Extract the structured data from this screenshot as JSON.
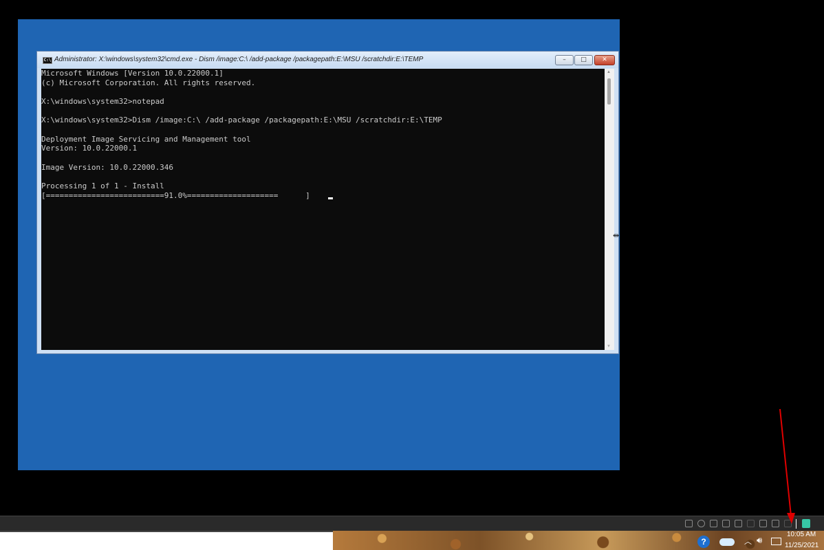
{
  "cmd_window": {
    "title": "Administrator: X:\\windows\\system32\\cmd.exe - Dism  /image:C:\\ /add-package /packagepath:E:\\MSU /scratchdir:E:\\TEMP",
    "icon": "cmd-icon",
    "buttons": {
      "minimize": "–",
      "maximize": "□",
      "close": "✕"
    },
    "console_lines": [
      "Microsoft Windows [Version 10.0.22000.1]",
      "(c) Microsoft Corporation. All rights reserved.",
      "",
      "X:\\windows\\system32>notepad",
      "",
      "X:\\windows\\system32>Dism /image:C:\\ /add-package /packagepath:E:\\MSU /scratchdir:E:\\TEMP",
      "",
      "Deployment Image Servicing and Management tool",
      "Version: 10.0.22000.1",
      "",
      "Image Version: 10.0.22000.346",
      "",
      "Processing 1 of 1 - Install",
      "[==========================91.0%====================      ]"
    ],
    "progress_percent": 91.0
  },
  "taskbar": {
    "clock_time": "10:05 AM",
    "clock_date": "11/25/2021",
    "help_icon_label": "?",
    "tray_icons": [
      "network-drive-icon",
      "sync-icon",
      "display-icon",
      "printer-icon",
      "speaker-icon",
      "arrow-icon",
      "trash-icon",
      "device-icon",
      "wifi-icon",
      "app-icon"
    ]
  },
  "colors": {
    "vm_background": "#1f65b3",
    "console_background": "#0c0c0c",
    "console_text": "#cccccc",
    "annotation_arrow": "#e00000"
  }
}
